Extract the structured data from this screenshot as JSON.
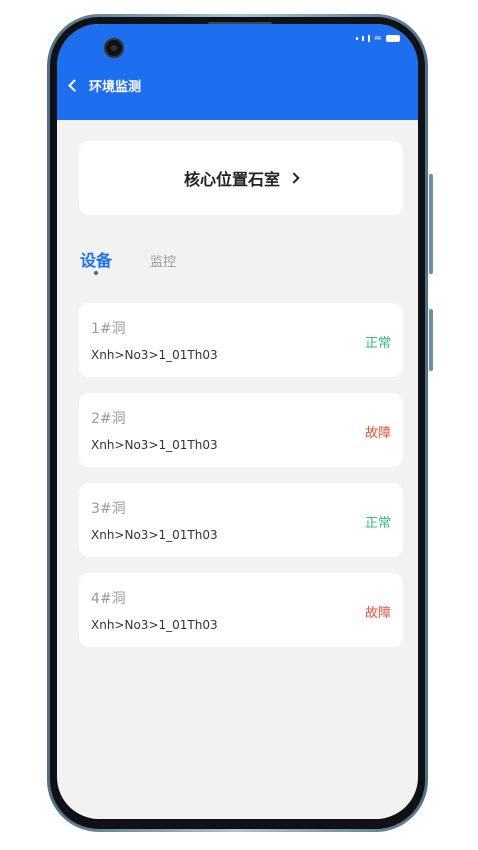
{
  "header": {
    "title": "环境监测",
    "back_icon": "chevron-left-icon"
  },
  "location": {
    "label": "核心位置石室",
    "icon": "chevron-right-icon"
  },
  "tabs": [
    {
      "label": "设备",
      "active": true
    },
    {
      "label": "监控",
      "active": false
    }
  ],
  "devices": [
    {
      "name": "1#洞",
      "path": "Xnh>No3>1_01Th03",
      "status": "正常",
      "status_color": "#2fbf7a"
    },
    {
      "name": "2#洞",
      "path": "Xnh>No3>1_01Th03",
      "status": "故障",
      "status_color": "#ee4e35"
    },
    {
      "name": "3#洞",
      "path": "Xnh>No3>1_01Th03",
      "status": "正常",
      "status_color": "#2fbf7a"
    },
    {
      "name": "4#洞",
      "path": "Xnh>No3>1_01Th03",
      "status": "故障",
      "status_color": "#ee4e35"
    }
  ],
  "colors": {
    "accent": "#1e6ff0",
    "ok": "#2fbf7a",
    "fault": "#ee4e35"
  }
}
